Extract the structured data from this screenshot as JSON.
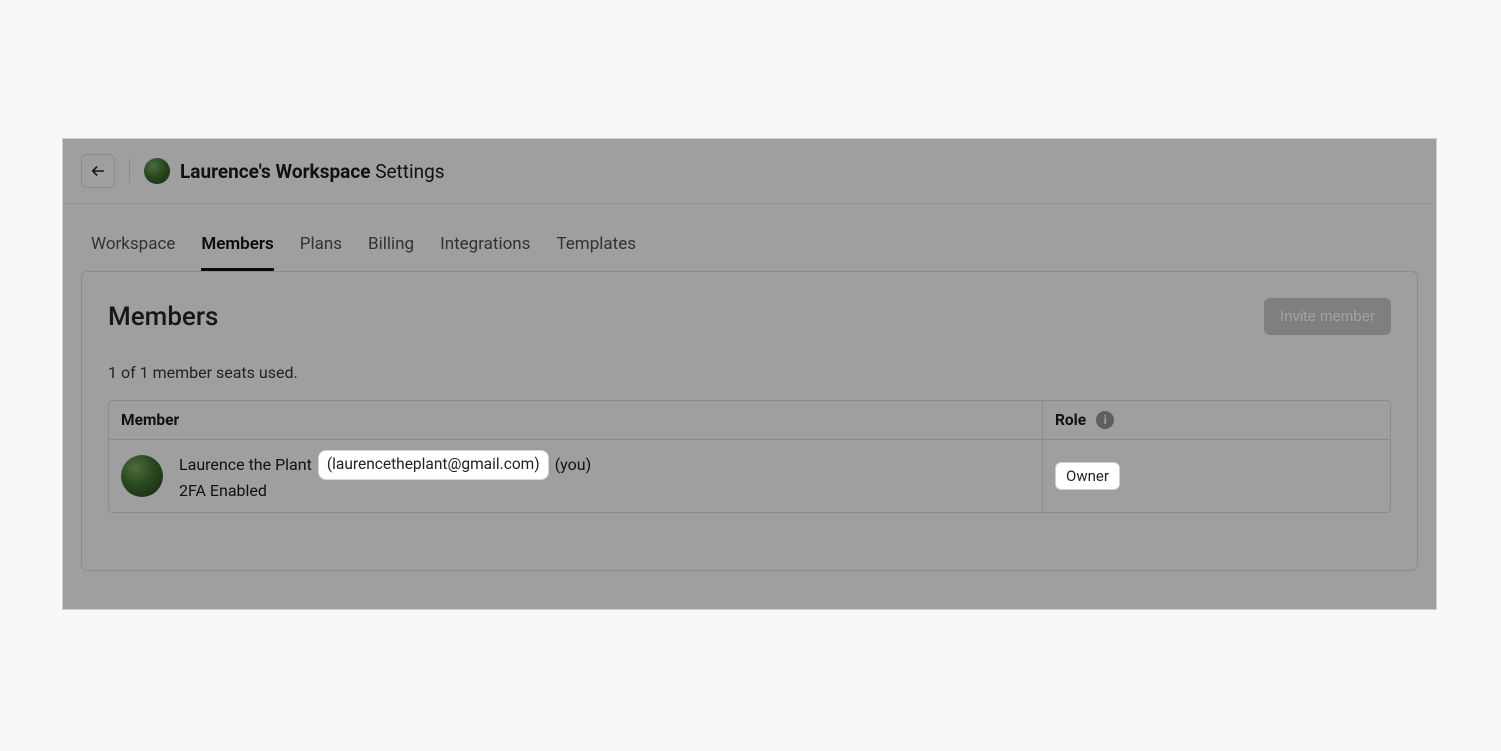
{
  "header": {
    "workspace_name": "Laurence's Workspace",
    "settings_suffix": "Settings"
  },
  "tabs": [
    {
      "id": "workspace",
      "label": "Workspace",
      "active": false
    },
    {
      "id": "members",
      "label": "Members",
      "active": true
    },
    {
      "id": "plans",
      "label": "Plans",
      "active": false
    },
    {
      "id": "billing",
      "label": "Billing",
      "active": false
    },
    {
      "id": "integrations",
      "label": "Integrations",
      "active": false
    },
    {
      "id": "templates",
      "label": "Templates",
      "active": false
    }
  ],
  "members_panel": {
    "title": "Members",
    "invite_button": "Invite member",
    "seats_text": "1 of 1 member seats used.",
    "columns": {
      "member": "Member",
      "role": "Role"
    },
    "rows": [
      {
        "name": "Laurence the Plant",
        "email_display": "(laurencetheplant@gmail.com)",
        "you_suffix": "(you)",
        "mfa": "2FA Enabled",
        "role": "Owner"
      }
    ]
  }
}
